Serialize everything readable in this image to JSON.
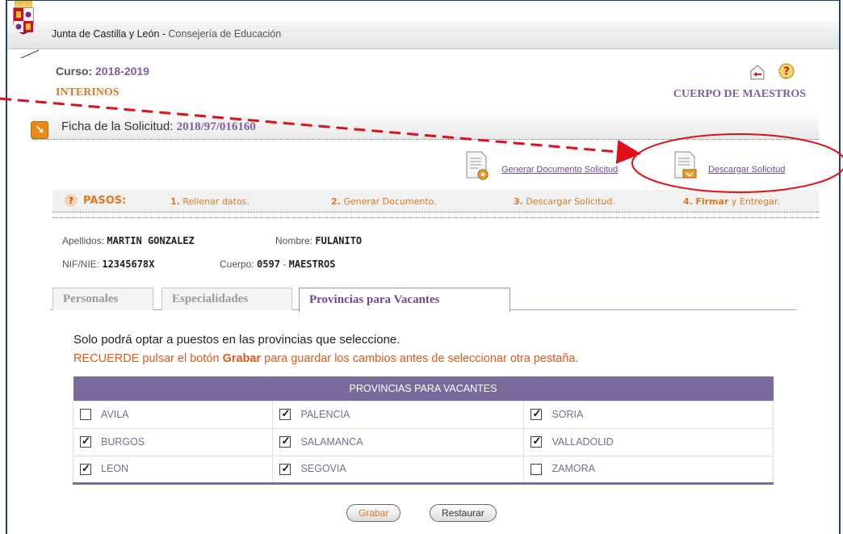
{
  "header": {
    "org": "Junta de Castilla y León",
    "separator": " - ",
    "dept": "Consejería de Educación"
  },
  "curso": {
    "label": "Curso:",
    "value": "2018-2019"
  },
  "tipo": "INTERINOS",
  "cuerpo_title": "CUERPO DE MAESTROS",
  "ficha": {
    "label": "Ficha de la Solicitud:",
    "numero": "2018/97/016160"
  },
  "actions": {
    "generar": "Generar Documento Solicitud",
    "descargar": "Descargar Solicitud"
  },
  "pasos": {
    "title": "PASOS:",
    "steps": [
      {
        "num": "1.",
        "text": "Rellenar datos."
      },
      {
        "num": "2.",
        "text": "Generar Documento."
      },
      {
        "num": "3.",
        "text": "Descargar Solicitud."
      },
      {
        "num": "4.",
        "bold": "Firmar",
        "text": "y Entregar."
      }
    ]
  },
  "persona": {
    "apellidos_label": "Apellidos:",
    "apellidos": "MARTIN GONZALEZ",
    "nombre_label": "Nombre:",
    "nombre": "FULANITO",
    "nif_label": "NIF/NIE:",
    "nif": "12345678X",
    "cuerpo_label": "Cuerpo:",
    "cuerpo_code": "0597",
    "cuerpo_sep": " - ",
    "cuerpo_name": "MAESTROS"
  },
  "tabs": [
    "Personales",
    "Especialidades",
    "Provincias para Vacantes"
  ],
  "messages": {
    "line1": "Solo podrá optar a puestos en las provincias que seleccione.",
    "line2_a": "RECUERDE pulsar el botón ",
    "line2_b": "Grabar",
    "line2_c": " para guardar los cambios antes de seleccionar otra pestaña."
  },
  "table": {
    "header": "PROVINCIAS PARA VACANTES",
    "rows": [
      [
        {
          "name": "AVILA",
          "checked": false
        },
        {
          "name": "PALENCIA",
          "checked": true
        },
        {
          "name": "SORIA",
          "checked": true
        }
      ],
      [
        {
          "name": "BURGOS",
          "checked": true
        },
        {
          "name": "SALAMANCA",
          "checked": true
        },
        {
          "name": "VALLADOLID",
          "checked": true
        }
      ],
      [
        {
          "name": "LEON",
          "checked": true
        },
        {
          "name": "SEGOVIA",
          "checked": true
        },
        {
          "name": "ZAMORA",
          "checked": false
        }
      ]
    ]
  },
  "buttons": {
    "grabar": "Grabar",
    "restaurar": "Restaurar"
  },
  "colors": {
    "accent": "#7a6a9c",
    "orange": "#e07820",
    "annotation": "#e0101a",
    "frame": "#1d3e6e"
  }
}
